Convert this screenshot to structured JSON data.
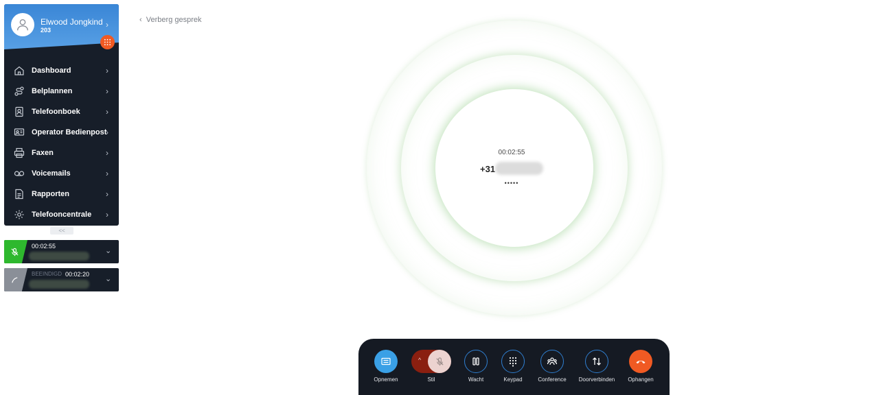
{
  "user": {
    "name": "Elwood Jongkind",
    "extension": "203"
  },
  "nav": {
    "items": [
      {
        "label": "Dashboard",
        "icon": "home-icon"
      },
      {
        "label": "Belplannen",
        "icon": "route-icon"
      },
      {
        "label": "Telefoonboek",
        "icon": "contact-book-icon"
      },
      {
        "label": "Operator Bedienpost",
        "icon": "operator-icon"
      },
      {
        "label": "Faxen",
        "icon": "printer-icon"
      },
      {
        "label": "Voicemails",
        "icon": "voicemail-icon"
      },
      {
        "label": "Rapporten",
        "icon": "report-icon"
      },
      {
        "label": "Telefooncentrale",
        "icon": "gear-icon"
      }
    ],
    "collapse_label": "<<"
  },
  "calls": [
    {
      "status": "",
      "time": "00:02:55",
      "color": "#2eb82e",
      "icon": "mic-muted-icon"
    },
    {
      "status": "BEEINDIGD",
      "time": "00:02:20",
      "color": "#8a8f98",
      "icon": "phone-icon"
    }
  ],
  "main": {
    "hide_label": "Verberg gesprek",
    "call_timer": "00:02:55",
    "number_prefix": "+31",
    "dots": "•••••"
  },
  "controls": [
    {
      "label": "Opnemen",
      "icon": "record-icon"
    },
    {
      "label": "Stil",
      "icon": "mic-muted-icon"
    },
    {
      "label": "Wacht",
      "icon": "pause-icon"
    },
    {
      "label": "Keypad",
      "icon": "keypad-icon"
    },
    {
      "label": "Conference",
      "icon": "conference-icon"
    },
    {
      "label": "Doorverbinden",
      "icon": "transfer-icon"
    },
    {
      "label": "Ophangen",
      "icon": "hangup-icon"
    }
  ],
  "colors": {
    "sidebar_bg": "#171e29",
    "profile_blue": "#4a94dc",
    "accent_orange": "#f05a23",
    "active_green": "#2eb82e",
    "hangup_orange": "#f05a23",
    "record_blue": "#3aa0e6",
    "mute_red": "#8a1f10"
  }
}
